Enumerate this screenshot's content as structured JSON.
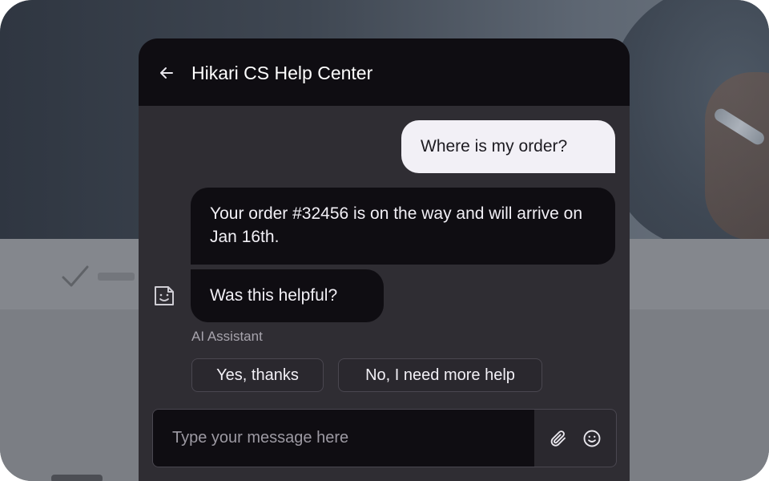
{
  "header": {
    "title": "Hikari CS Help Center",
    "back_icon": "arrow-left-icon"
  },
  "messages": [
    {
      "sender": "user",
      "text": "Where is my order?"
    },
    {
      "sender": "bot",
      "text": "Your order #32456 is on the way and will arrive on Jan 16th."
    },
    {
      "sender": "bot",
      "text": "Was this helpful?"
    }
  ],
  "bot": {
    "label": "AI Assistant",
    "avatar_icon": "bot-face-icon"
  },
  "quick_replies": [
    {
      "label": "Yes, thanks"
    },
    {
      "label": "No, I need more help"
    }
  ],
  "composer": {
    "placeholder": "Type your message here",
    "value": "",
    "attach_icon": "paperclip-icon",
    "emoji_icon": "smiley-icon"
  },
  "colors": {
    "header_bg": "#0f0d12",
    "panel_bg": "#2f2d33",
    "user_bubble_bg": "#f2f0f6",
    "bot_bubble_bg": "#0f0d12",
    "text_light": "#f2f0f6",
    "text_muted": "#a7a4ad"
  }
}
